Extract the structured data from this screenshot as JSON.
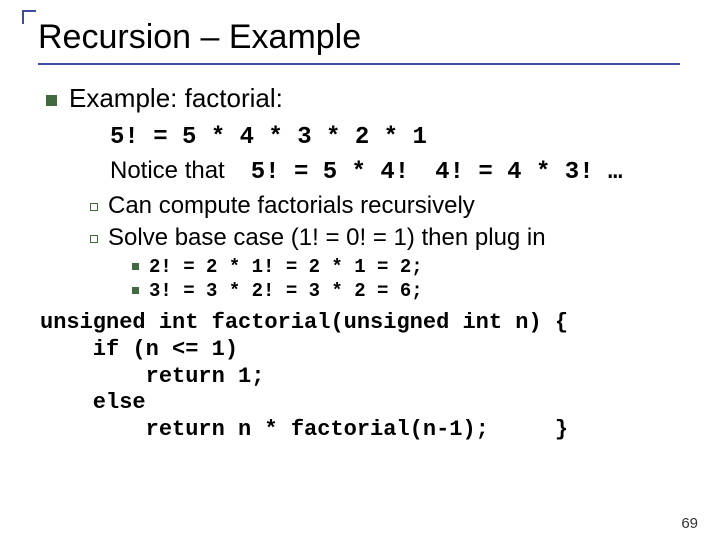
{
  "title": "Recursion – Example",
  "lvl1": "Example: factorial:",
  "factExpansion": "5! = 5 * 4 * 3 * 2 * 1",
  "noticeLabel": "Notice that",
  "noticeEq1": "5! = 5 * 4!",
  "noticeEq2": "4! = 4 * 3! …",
  "sub1": "Can compute factorials recursively",
  "sub2": "Solve base case (1! = 0! = 1) then plug in",
  "step1": "2! = 2 * 1! = 2 * 1 = 2;",
  "step2": "3! = 3 * 2! = 3 * 2 = 6;",
  "code": "unsigned int factorial(unsigned int n) {\n    if (n <= 1)\n        return 1;\n    else\n        return n * factorial(n-1);     }",
  "pageNumber": "69"
}
